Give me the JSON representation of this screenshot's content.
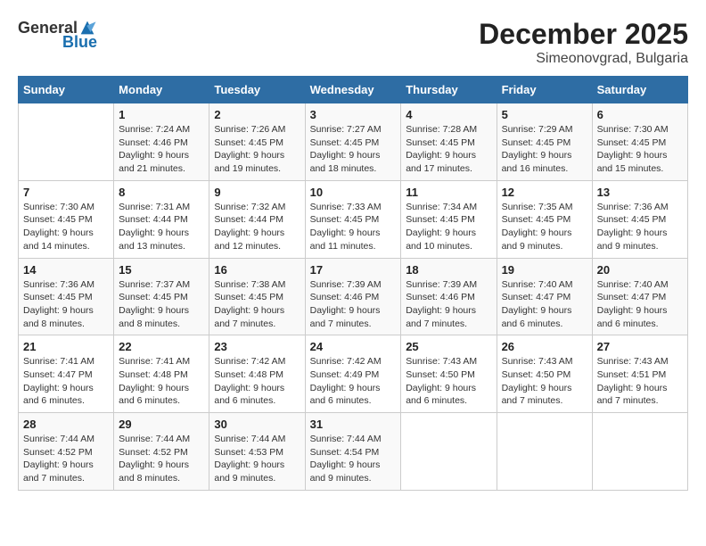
{
  "logo": {
    "general": "General",
    "blue": "Blue"
  },
  "title": "December 2025",
  "subtitle": "Simeonovgrad, Bulgaria",
  "weekdays": [
    "Sunday",
    "Monday",
    "Tuesday",
    "Wednesday",
    "Thursday",
    "Friday",
    "Saturday"
  ],
  "weeks": [
    [
      {
        "day": "",
        "sunrise": "",
        "sunset": "",
        "daylight": ""
      },
      {
        "day": "1",
        "sunrise": "Sunrise: 7:24 AM",
        "sunset": "Sunset: 4:46 PM",
        "daylight": "Daylight: 9 hours and 21 minutes."
      },
      {
        "day": "2",
        "sunrise": "Sunrise: 7:26 AM",
        "sunset": "Sunset: 4:45 PM",
        "daylight": "Daylight: 9 hours and 19 minutes."
      },
      {
        "day": "3",
        "sunrise": "Sunrise: 7:27 AM",
        "sunset": "Sunset: 4:45 PM",
        "daylight": "Daylight: 9 hours and 18 minutes."
      },
      {
        "day": "4",
        "sunrise": "Sunrise: 7:28 AM",
        "sunset": "Sunset: 4:45 PM",
        "daylight": "Daylight: 9 hours and 17 minutes."
      },
      {
        "day": "5",
        "sunrise": "Sunrise: 7:29 AM",
        "sunset": "Sunset: 4:45 PM",
        "daylight": "Daylight: 9 hours and 16 minutes."
      },
      {
        "day": "6",
        "sunrise": "Sunrise: 7:30 AM",
        "sunset": "Sunset: 4:45 PM",
        "daylight": "Daylight: 9 hours and 15 minutes."
      }
    ],
    [
      {
        "day": "7",
        "sunrise": "Sunrise: 7:30 AM",
        "sunset": "Sunset: 4:45 PM",
        "daylight": "Daylight: 9 hours and 14 minutes."
      },
      {
        "day": "8",
        "sunrise": "Sunrise: 7:31 AM",
        "sunset": "Sunset: 4:44 PM",
        "daylight": "Daylight: 9 hours and 13 minutes."
      },
      {
        "day": "9",
        "sunrise": "Sunrise: 7:32 AM",
        "sunset": "Sunset: 4:44 PM",
        "daylight": "Daylight: 9 hours and 12 minutes."
      },
      {
        "day": "10",
        "sunrise": "Sunrise: 7:33 AM",
        "sunset": "Sunset: 4:45 PM",
        "daylight": "Daylight: 9 hours and 11 minutes."
      },
      {
        "day": "11",
        "sunrise": "Sunrise: 7:34 AM",
        "sunset": "Sunset: 4:45 PM",
        "daylight": "Daylight: 9 hours and 10 minutes."
      },
      {
        "day": "12",
        "sunrise": "Sunrise: 7:35 AM",
        "sunset": "Sunset: 4:45 PM",
        "daylight": "Daylight: 9 hours and 9 minutes."
      },
      {
        "day": "13",
        "sunrise": "Sunrise: 7:36 AM",
        "sunset": "Sunset: 4:45 PM",
        "daylight": "Daylight: 9 hours and 9 minutes."
      }
    ],
    [
      {
        "day": "14",
        "sunrise": "Sunrise: 7:36 AM",
        "sunset": "Sunset: 4:45 PM",
        "daylight": "Daylight: 9 hours and 8 minutes."
      },
      {
        "day": "15",
        "sunrise": "Sunrise: 7:37 AM",
        "sunset": "Sunset: 4:45 PM",
        "daylight": "Daylight: 9 hours and 8 minutes."
      },
      {
        "day": "16",
        "sunrise": "Sunrise: 7:38 AM",
        "sunset": "Sunset: 4:45 PM",
        "daylight": "Daylight: 9 hours and 7 minutes."
      },
      {
        "day": "17",
        "sunrise": "Sunrise: 7:39 AM",
        "sunset": "Sunset: 4:46 PM",
        "daylight": "Daylight: 9 hours and 7 minutes."
      },
      {
        "day": "18",
        "sunrise": "Sunrise: 7:39 AM",
        "sunset": "Sunset: 4:46 PM",
        "daylight": "Daylight: 9 hours and 7 minutes."
      },
      {
        "day": "19",
        "sunrise": "Sunrise: 7:40 AM",
        "sunset": "Sunset: 4:47 PM",
        "daylight": "Daylight: 9 hours and 6 minutes."
      },
      {
        "day": "20",
        "sunrise": "Sunrise: 7:40 AM",
        "sunset": "Sunset: 4:47 PM",
        "daylight": "Daylight: 9 hours and 6 minutes."
      }
    ],
    [
      {
        "day": "21",
        "sunrise": "Sunrise: 7:41 AM",
        "sunset": "Sunset: 4:47 PM",
        "daylight": "Daylight: 9 hours and 6 minutes."
      },
      {
        "day": "22",
        "sunrise": "Sunrise: 7:41 AM",
        "sunset": "Sunset: 4:48 PM",
        "daylight": "Daylight: 9 hours and 6 minutes."
      },
      {
        "day": "23",
        "sunrise": "Sunrise: 7:42 AM",
        "sunset": "Sunset: 4:48 PM",
        "daylight": "Daylight: 9 hours and 6 minutes."
      },
      {
        "day": "24",
        "sunrise": "Sunrise: 7:42 AM",
        "sunset": "Sunset: 4:49 PM",
        "daylight": "Daylight: 9 hours and 6 minutes."
      },
      {
        "day": "25",
        "sunrise": "Sunrise: 7:43 AM",
        "sunset": "Sunset: 4:50 PM",
        "daylight": "Daylight: 9 hours and 6 minutes."
      },
      {
        "day": "26",
        "sunrise": "Sunrise: 7:43 AM",
        "sunset": "Sunset: 4:50 PM",
        "daylight": "Daylight: 9 hours and 7 minutes."
      },
      {
        "day": "27",
        "sunrise": "Sunrise: 7:43 AM",
        "sunset": "Sunset: 4:51 PM",
        "daylight": "Daylight: 9 hours and 7 minutes."
      }
    ],
    [
      {
        "day": "28",
        "sunrise": "Sunrise: 7:44 AM",
        "sunset": "Sunset: 4:52 PM",
        "daylight": "Daylight: 9 hours and 7 minutes."
      },
      {
        "day": "29",
        "sunrise": "Sunrise: 7:44 AM",
        "sunset": "Sunset: 4:52 PM",
        "daylight": "Daylight: 9 hours and 8 minutes."
      },
      {
        "day": "30",
        "sunrise": "Sunrise: 7:44 AM",
        "sunset": "Sunset: 4:53 PM",
        "daylight": "Daylight: 9 hours and 9 minutes."
      },
      {
        "day": "31",
        "sunrise": "Sunrise: 7:44 AM",
        "sunset": "Sunset: 4:54 PM",
        "daylight": "Daylight: 9 hours and 9 minutes."
      },
      {
        "day": "",
        "sunrise": "",
        "sunset": "",
        "daylight": ""
      },
      {
        "day": "",
        "sunrise": "",
        "sunset": "",
        "daylight": ""
      },
      {
        "day": "",
        "sunrise": "",
        "sunset": "",
        "daylight": ""
      }
    ]
  ]
}
